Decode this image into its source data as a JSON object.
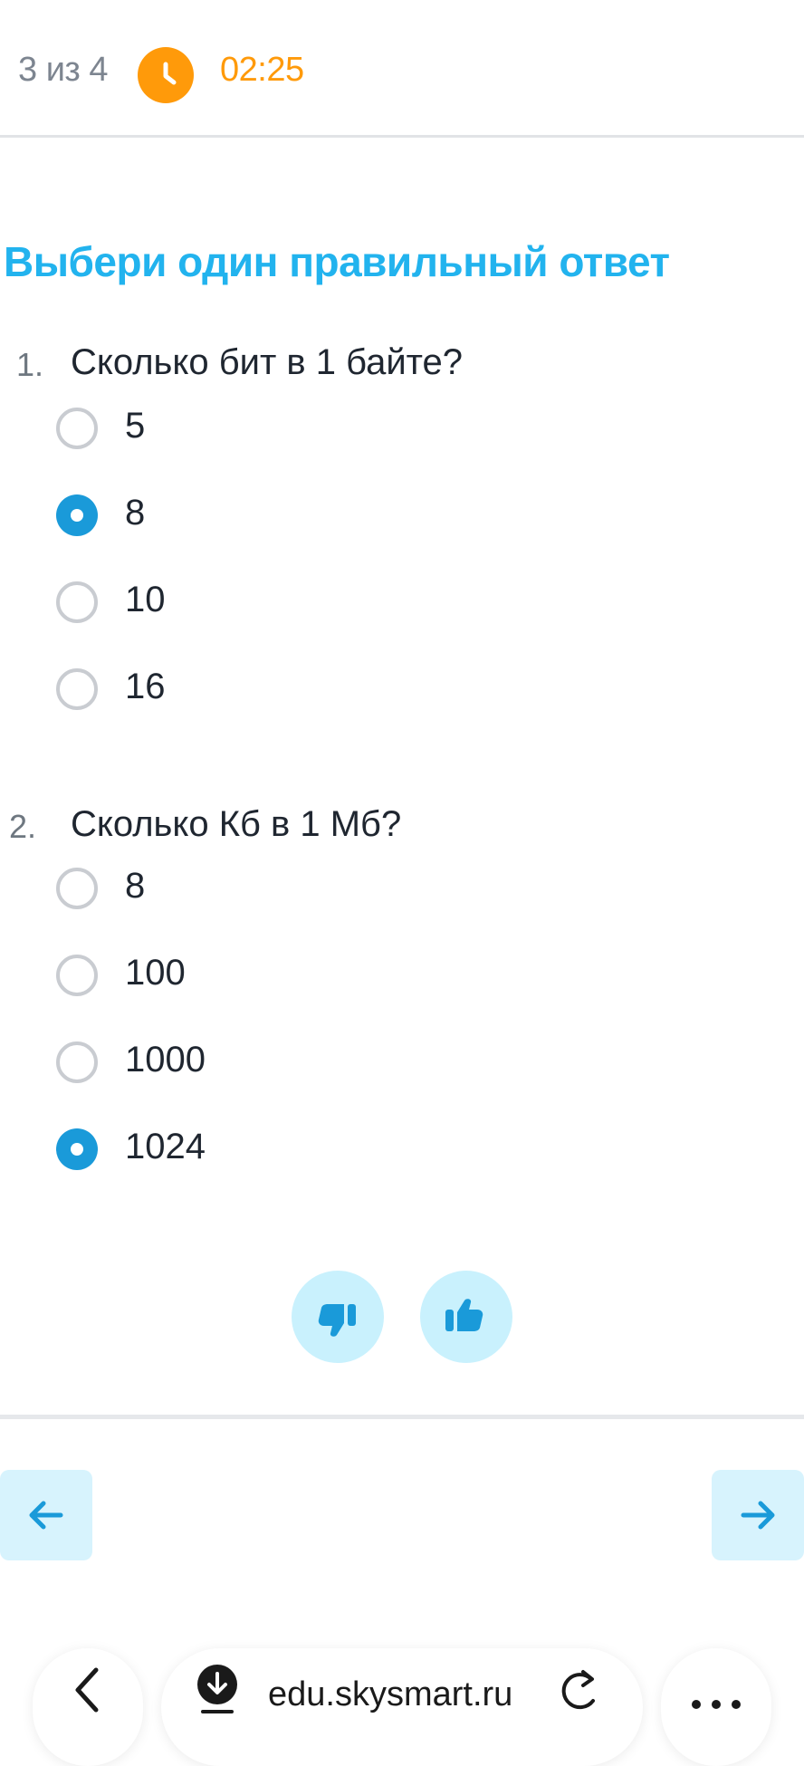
{
  "header": {
    "progress": "3 из 4",
    "timer": "02:25",
    "accent_color": "#ff9a0a"
  },
  "instruction": "Выбери один правильный ответ",
  "questions": [
    {
      "number": "1.",
      "text": "Сколько бит в 1 байте?",
      "options": [
        "5",
        "8",
        "10",
        "16"
      ],
      "selected": "8"
    },
    {
      "number": "2.",
      "text": "Сколько Кб в 1 Мб?",
      "options": [
        "8",
        "100",
        "1000",
        "1024"
      ],
      "selected": "1024"
    }
  ],
  "feedback": {
    "dislike_icon": "thumbs-down-icon",
    "like_icon": "thumbs-up-icon"
  },
  "navigation": {
    "prev_icon": "arrow-left-icon",
    "next_icon": "arrow-right-icon"
  },
  "browser": {
    "url": "edu.skysmart.ru",
    "back_icon": "chevron-left-icon",
    "download_icon": "download-icon",
    "reload_icon": "reload-icon",
    "menu_icon": "more-icon"
  }
}
